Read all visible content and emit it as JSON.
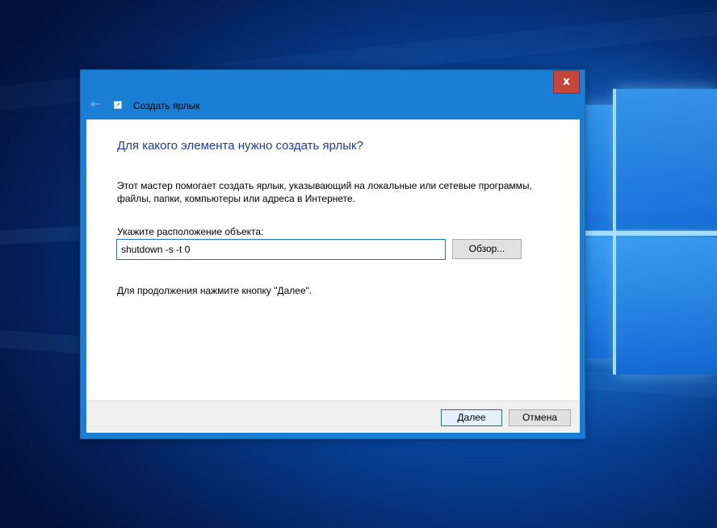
{
  "desktop": {
    "wallpaper": "windows-10-logo-wallpaper"
  },
  "dialog": {
    "title": "Создать ярлык",
    "close_label": "x",
    "back_icon": "back-arrow-icon",
    "title_icon": "shortcut-wizard-icon",
    "accent_color": "#1a7fd4",
    "close_color": "#c7463a"
  },
  "content": {
    "heading": "Для какого элемента нужно создать ярлык?",
    "description": "Этот мастер помогает создать ярлык, указывающий на локальные или сетевые программы, файлы, папки, компьютеры или адреса в Интернете.",
    "location_label": "Укажите расположение объекта:",
    "location_value": "shutdown -s -t 0",
    "browse_label": "Обзор...",
    "continue_hint": "Для продолжения нажмите кнопку \"Далее\"."
  },
  "footer": {
    "next_label": "Далее",
    "cancel_label": "Отмена"
  }
}
